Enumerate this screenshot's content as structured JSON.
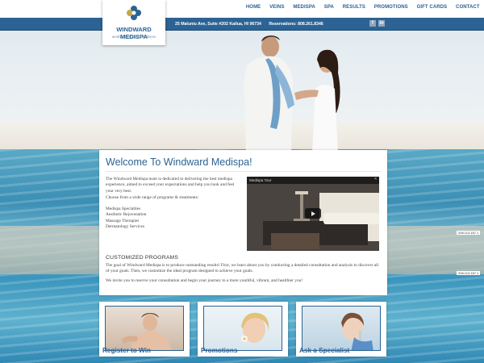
{
  "logo": {
    "name": "WINDWARD MEDISPA",
    "tagline": "aesthetics | veins | wellness"
  },
  "nav": {
    "items": [
      "HOME",
      "VEINS",
      "MEDISPA",
      "SPA",
      "RESULTS",
      "PROMOTIONS",
      "GIFT CARDS",
      "CONTACT"
    ]
  },
  "infobar": {
    "address": "25 Maluniu Ave, Suite #202 Kailua, HI 96734",
    "reservations": "Reservations: 808.261.8346"
  },
  "social": {
    "facebook": "f",
    "linkedin": "in"
  },
  "main": {
    "title": "Welcome To Windward Medispa!",
    "intro": "The Windward Medispa team is dedicated to delivering the best medispa experience, aimed to exceed your expectations and help you look and feel your very best.",
    "choose": "Choose from a wide range of programs & treatments:",
    "list": [
      "Medispa Specialties",
      "Aesthetic Rejuvenation",
      "Massage Therapies",
      "Dermatology Services"
    ],
    "video_title": "Medispa Tour",
    "section_title": "CUSTOMIZED PROGRAMS",
    "goal": "The goal of Windward Medispa is to produce outstanding results! First, we learn about you by conducting a detailed consultation and analysis to discover all of your goals. Then, we customize the ideal program designed to achieve your goals.",
    "invite": "We invite you to reserve your consultation and begin your journey to a more youthful, vibrant, and healthier you!"
  },
  "cards": [
    {
      "label": "Register to Win"
    },
    {
      "label": "Promotions"
    },
    {
      "label": "Ask a Specialist"
    }
  ],
  "ip_notes": [
    "208.113.187.1",
    "208.113.187.1"
  ],
  "colors": {
    "brand": "#2c6394",
    "infobar": "#2c6394"
  }
}
